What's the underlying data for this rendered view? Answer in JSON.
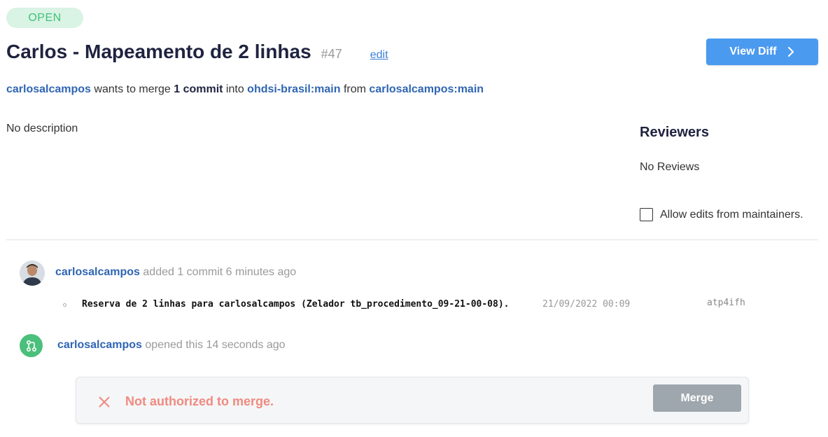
{
  "status": {
    "label": "OPEN"
  },
  "pr": {
    "title": "Carlos - Mapeamento de 2 linhas",
    "number": "#47",
    "edit_label": "edit"
  },
  "view_diff": {
    "label": "View Diff",
    "icon": "chevron-right-icon"
  },
  "merge_summary": {
    "author": "carlosalcampos",
    "text1": " wants to merge ",
    "commit_count": "1 commit",
    "text2": " into ",
    "target_branch": "ohdsi-brasil:main",
    "text3": " from ",
    "source_branch": "carlosalcampos:main"
  },
  "description": "No description",
  "reviewers": {
    "title": "Reviewers",
    "empty": "No Reviews",
    "allow_edits_label": "Allow edits from maintainers.",
    "allow_edits_checked": false
  },
  "timeline": {
    "commit_event": {
      "user": "carlosalcampos",
      "action": " added 1 commit 6 minutes ago"
    },
    "commits": [
      {
        "message": "Reserva de 2 linhas para carlosalcampos (Zelador tb_procedimento_09-21-00-08).",
        "date": "21/09/2022 00:09",
        "hash": "atp4ifh"
      }
    ],
    "open_event": {
      "user": "carlosalcampos",
      "action": " opened this 14 seconds ago"
    }
  },
  "merge_box": {
    "error": "Not authorized to merge.",
    "button_label": "Merge",
    "error_color": "#f08a80"
  },
  "colors": {
    "accent": "#4a9af0",
    "link": "#2f65b3",
    "open_green": "#41c37a"
  }
}
